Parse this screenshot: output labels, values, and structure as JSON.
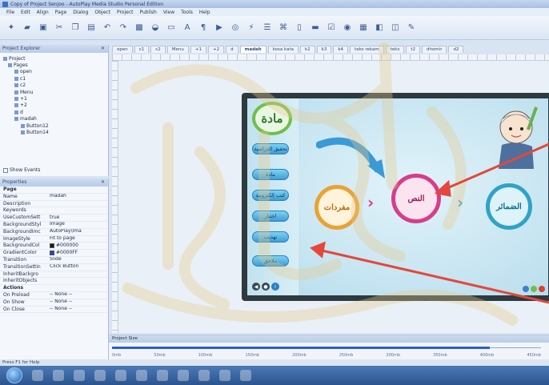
{
  "window": {
    "title": "Copy of Project Senjoo - AutoPlay Media Studio Personal Edition"
  },
  "menu": [
    "File",
    "Edit",
    "Align",
    "Page",
    "Dialog",
    "Object",
    "Project",
    "Publish",
    "View",
    "Tools",
    "Help"
  ],
  "explorer": {
    "header": "Project Explorer",
    "tree": [
      {
        "label": "Project",
        "level": 0
      },
      {
        "label": "Pages",
        "level": 1
      },
      {
        "label": "open",
        "level": 2
      },
      {
        "label": "c1",
        "level": 2
      },
      {
        "label": "c2",
        "level": 2
      },
      {
        "label": "Menu",
        "level": 2
      },
      {
        "label": "+1",
        "level": 2
      },
      {
        "label": "+2",
        "level": 2
      },
      {
        "label": "d",
        "level": 2
      },
      {
        "label": "madah",
        "level": 2
      },
      {
        "label": "Button12",
        "level": 3
      },
      {
        "label": "Button14",
        "level": 3
      }
    ],
    "show_events": "Show Events"
  },
  "properties": {
    "header": "Properties",
    "rows": [
      {
        "key": "Page",
        "value": "",
        "section": true
      },
      {
        "key": "Name",
        "value": "madah"
      },
      {
        "key": "Description",
        "value": ""
      },
      {
        "key": "Keywords",
        "value": ""
      },
      {
        "key": "UseCustomSett",
        "value": "true"
      },
      {
        "key": "BackgroundStyl",
        "value": "Image"
      },
      {
        "key": "BackgroundImc",
        "value": "AutoPlay\\Ima"
      },
      {
        "key": "ImageStyle",
        "value": "Fit to page"
      },
      {
        "key": "BackgroundCol",
        "value": "#000000",
        "swatch": "#1b1b1b"
      },
      {
        "key": "GradientColor",
        "value": "#0000FF",
        "swatch": "#2342d6"
      },
      {
        "key": "Transition",
        "value": "Slide"
      },
      {
        "key": "TransitionSettin",
        "value": "Click Button"
      },
      {
        "key": "InheritBackgro",
        "value": ""
      },
      {
        "key": "InheritObjects",
        "value": ""
      },
      {
        "key": "Actions",
        "value": "",
        "section": true
      },
      {
        "key": "On Preload",
        "value": "-- None --"
      },
      {
        "key": "On Show",
        "value": "-- None --"
      },
      {
        "key": "On Close",
        "value": "-- None --"
      }
    ]
  },
  "tabs": [
    "open",
    "c1",
    "c2",
    "Menu",
    "+1",
    "+2",
    "d",
    "madah",
    "kosa kata",
    "k2",
    "k3",
    "k4",
    "teks rekam",
    "teks",
    "t2",
    "dhomir",
    "d2"
  ],
  "slide": {
    "title_circle": "مادة",
    "side_buttons": [
      "تحقيق الدراسية",
      "مادة",
      "كتب إلكترونية",
      "اختبار",
      "تهذيب",
      "ملاحق"
    ],
    "circles": [
      "مفردات",
      "النص",
      "الضمائر"
    ]
  },
  "bottom_panel": {
    "header": "Project Size",
    "ticks": [
      "0mb",
      "50mb",
      "100mb",
      "150mb",
      "200mb",
      "250mb",
      "300mb",
      "350mb",
      "400mb",
      "450mb"
    ],
    "used_fraction": 0.88
  },
  "status": "Press F1 for Help",
  "colors": {
    "arrow": "#e5473a",
    "accent": "#2d5fc3"
  }
}
